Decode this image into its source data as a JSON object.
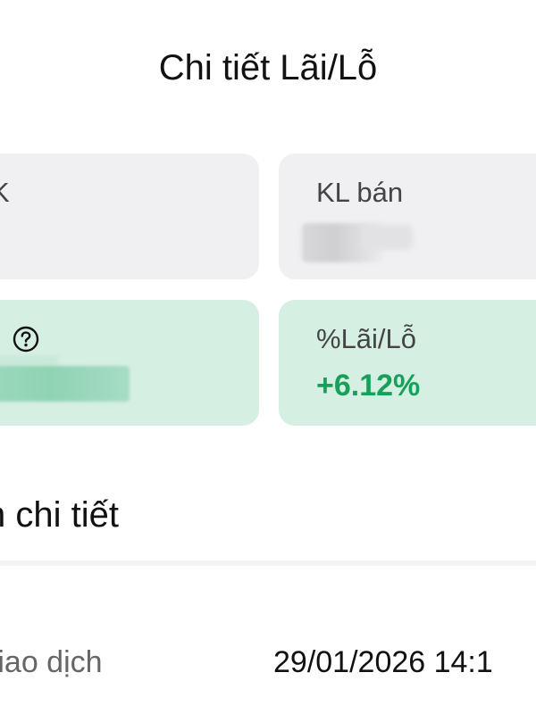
{
  "header": {
    "title": "Chi tiết Lãi/Lỗ"
  },
  "cards": {
    "top_left": {
      "label": "K"
    },
    "top_right": {
      "label": "KL bán"
    },
    "bottom_left": {
      "help_icon": "question-circle-icon"
    },
    "bottom_right": {
      "label": "%Lãi/Lỗ",
      "value": "+6.12%"
    }
  },
  "details": {
    "section_title": "tin chi tiết",
    "rows": [
      {
        "label": "y giao dịch",
        "value": "29/01/2026 14:1"
      }
    ]
  },
  "colors": {
    "positive": "#18a05a",
    "card_grey": "#f0f0f2",
    "card_green": "#d6efe3"
  }
}
